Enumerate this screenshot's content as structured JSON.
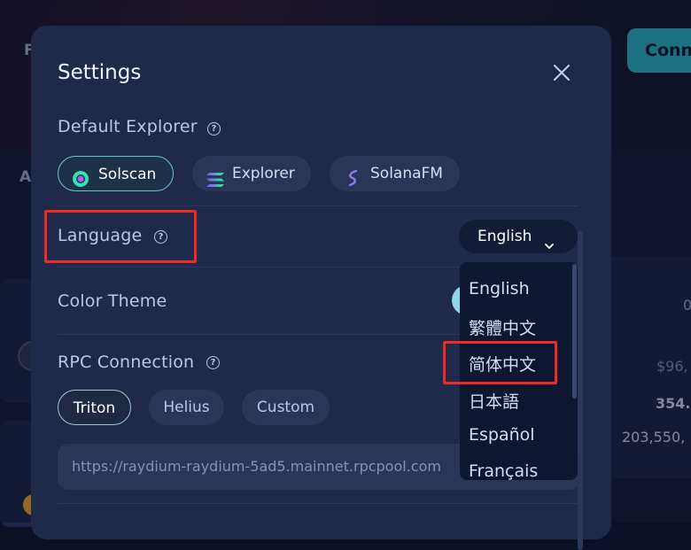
{
  "background": {
    "connect_label": "Conn",
    "letter_f": "F",
    "letter_a": "A",
    "col_value_top": "0",
    "price_value": "$96,",
    "amount_value": "354.",
    "big_value": "203,550,"
  },
  "modal": {
    "title": "Settings",
    "explorer": {
      "label": "Default Explorer",
      "options": [
        "Solscan",
        "Explorer",
        "SolanaFM"
      ],
      "selected": "Solscan"
    },
    "language": {
      "label": "Language",
      "selected": "English",
      "options": [
        "English",
        "繁體中文",
        "简体中文",
        "日本語",
        "Español",
        "Français"
      ]
    },
    "color_theme": {
      "label": "Color Theme"
    },
    "rpc": {
      "label": "RPC Connection",
      "options": [
        "Triton",
        "Helius",
        "Custom"
      ],
      "selected": "Triton",
      "url_value": "https://raydium-raydium-5ad5.mainnet.rpcpool.com"
    }
  },
  "colors": {
    "accent": "#6fc3cf",
    "highlight": "#ee2a22",
    "modal_bg": "#1f2a4b"
  }
}
